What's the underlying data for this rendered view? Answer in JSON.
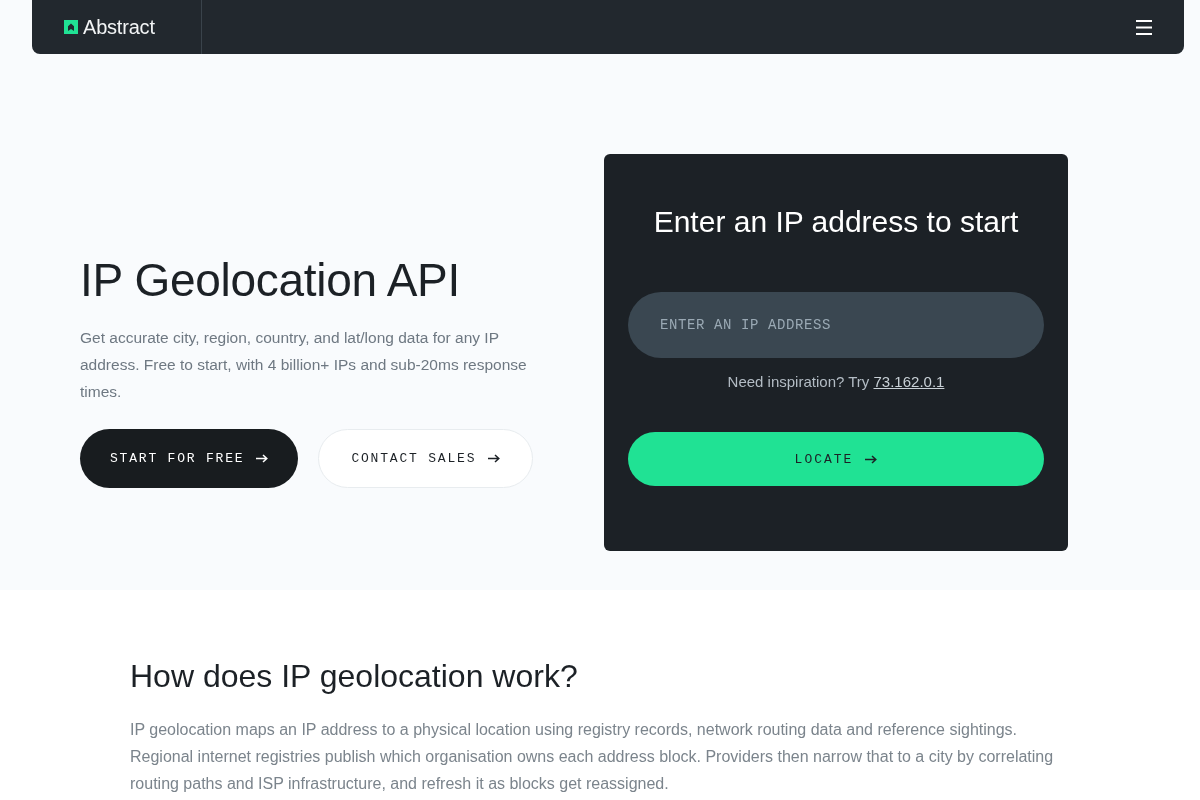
{
  "nav": {
    "logo": "Abstract"
  },
  "hero": {
    "title": "IP Geolocation API",
    "description": "Get accurate city, region, country, and lat/long data for any IP address. Free to start, with 4 billion+ IPs and sub-20ms response times.",
    "buttons": [
      {
        "label": "START FOR FREE",
        "kind": "primary"
      },
      {
        "label": "CONTACT SALES",
        "kind": "secondary"
      }
    ]
  },
  "lookup_card": {
    "title": "Enter an IP address to start",
    "input": {
      "placeholder": "ENTER AN IP ADDRESS"
    },
    "hint": "Need inspiration? Try",
    "example_link": "73.162.0.1",
    "button": {
      "label": "LOCATE"
    }
  },
  "section": {
    "heading": "How does IP geolocation work?",
    "paragraph": "IP geolocation maps an IP address to a physical location using registry records, network routing data and reference sightings. Regional internet registries publish which organisation owns each address block. Providers then narrow that to a city by correlating routing paths and ISP infrastructure, and refresh it as blocks get reassigned."
  }
}
